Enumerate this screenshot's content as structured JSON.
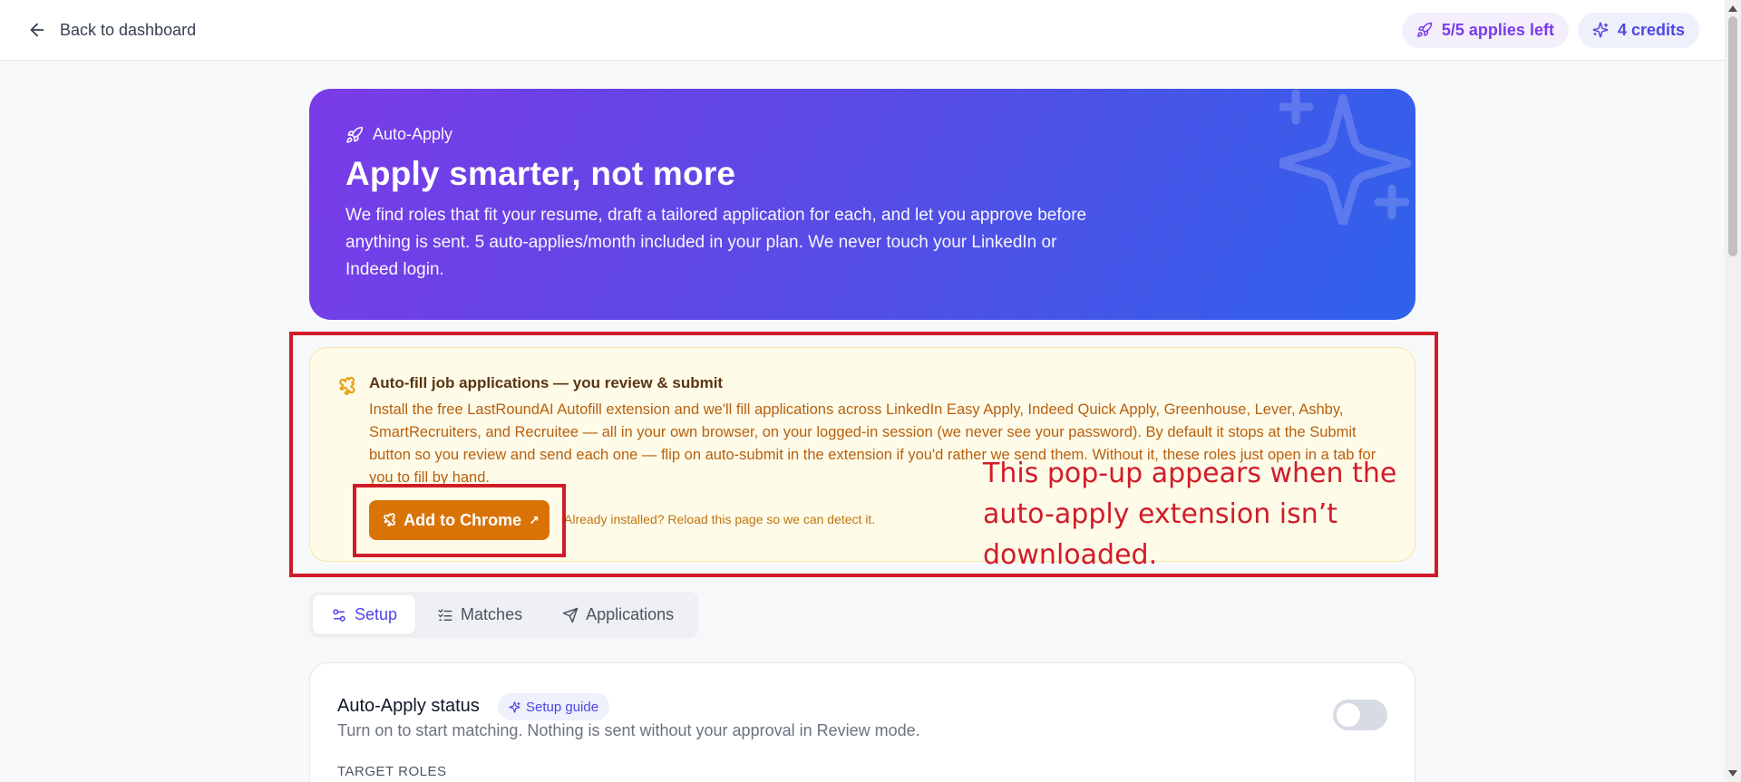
{
  "topbar": {
    "back_label": "Back to dashboard",
    "applies_pill": "5/5 applies left",
    "credits_pill": "4 credits"
  },
  "hero": {
    "eyebrow": "Auto-Apply",
    "title": "Apply smarter, not more",
    "description": "We find roles that fit your resume, draft a tailored application for each, and let you approve before anything is sent. 5 auto-applies/month included in your plan. We never touch your LinkedIn or Indeed login."
  },
  "notice": {
    "title": "Auto-fill job applications — you review & submit",
    "body": "Install the free LastRoundAI Autofill extension and we'll fill applications across LinkedIn Easy Apply, Indeed Quick Apply, Greenhouse, Lever, Ashby, SmartRecruiters, and Recruitee — all in your own browser, on your logged-in session (we never see your password). By default it stops at the Submit button so you review and send each one — flip on auto-submit in the extension if you'd rather we send them. Without it, these roles just open in a tab for you to fill by hand.",
    "button_label": "Add to Chrome",
    "button_ext_glyph": "↗",
    "hint": "Already installed? Reload this page so we can detect it."
  },
  "annotation": {
    "text": "This pop-up appears when the auto-apply extension isn’t downloaded.",
    "color": "#d01c2a"
  },
  "tabs": [
    {
      "label": "Setup",
      "active": true
    },
    {
      "label": "Matches",
      "active": false
    },
    {
      "label": "Applications",
      "active": false
    }
  ],
  "status_card": {
    "title": "Auto-Apply status",
    "guide_label": "Setup guide",
    "subtitle": "Turn on to start matching. Nothing is sent without your approval in Review mode.",
    "section_label": "TARGET ROLES",
    "toggle_on": false
  },
  "colors": {
    "accent": "#4f46e5",
    "hero_start": "#7a3be8",
    "hero_end": "#2e62eb",
    "notice_bg": "#fefbe8",
    "button": "#d97306"
  }
}
